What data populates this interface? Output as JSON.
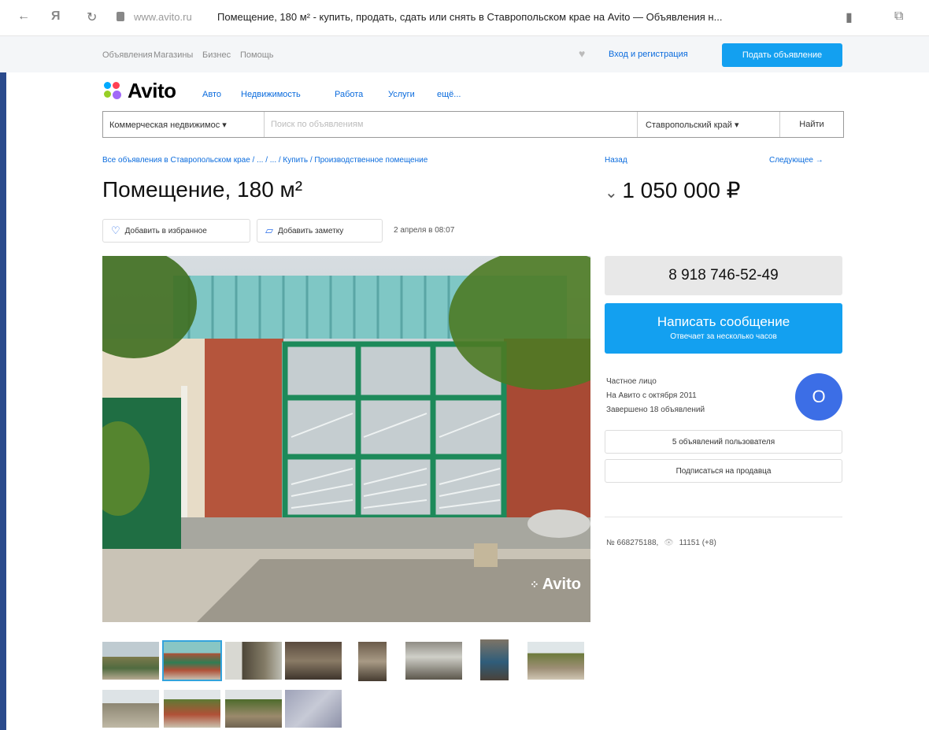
{
  "browser": {
    "url": "www.avito.ru",
    "tab_title": "Помещение, 180 м² - купить, продать, сдать или снять в Ставропольском крае на Avito — Объявления н..."
  },
  "topnav": {
    "items": [
      "Объявления",
      "Магазины",
      "Бизнес",
      "Помощь"
    ],
    "login": "Вход и регистрация",
    "post_ad": "Подать объявление"
  },
  "header": {
    "logo": "Avito",
    "categories": [
      "Авто",
      "Недвижимость",
      "Работа",
      "Услуги",
      "ещё..."
    ]
  },
  "search": {
    "category": "Коммерческая недвижимос ▾",
    "placeholder": "Поиск по объявлениям",
    "region": "Ставропольский край ▾",
    "button": "Найти"
  },
  "breadcrumb": "Все объявления в Ставропольском крае / ... / ... / Купить / Производственное помещение",
  "nav": {
    "back": "Назад",
    "next": "Следующее →"
  },
  "listing": {
    "title": "Помещение, 180 м²",
    "price": "1 050 000 ₽",
    "favorite": "Добавить в избранное",
    "note": "Добавить заметку",
    "date": "2 апреля в 08:07",
    "watermark": "Avito"
  },
  "contact": {
    "phone": "8 918 746-52-49",
    "message": "Написать сообщение",
    "message_sub": "Отвечает за несколько часов"
  },
  "seller": {
    "type": "Частное лицо",
    "since": "На Авито с октября 2011",
    "completed": "Завершено 18 объявлений",
    "avatar_letter": "О",
    "user_ads": "5 объявлений пользователя",
    "subscribe": "Подписаться на продавца"
  },
  "meta": {
    "id": "№ 668275188,",
    "views": "11151 (+8)"
  },
  "colors": {
    "accent": "#13a0f0",
    "link": "#0a6bdd",
    "avatar": "#3c6ee6"
  }
}
